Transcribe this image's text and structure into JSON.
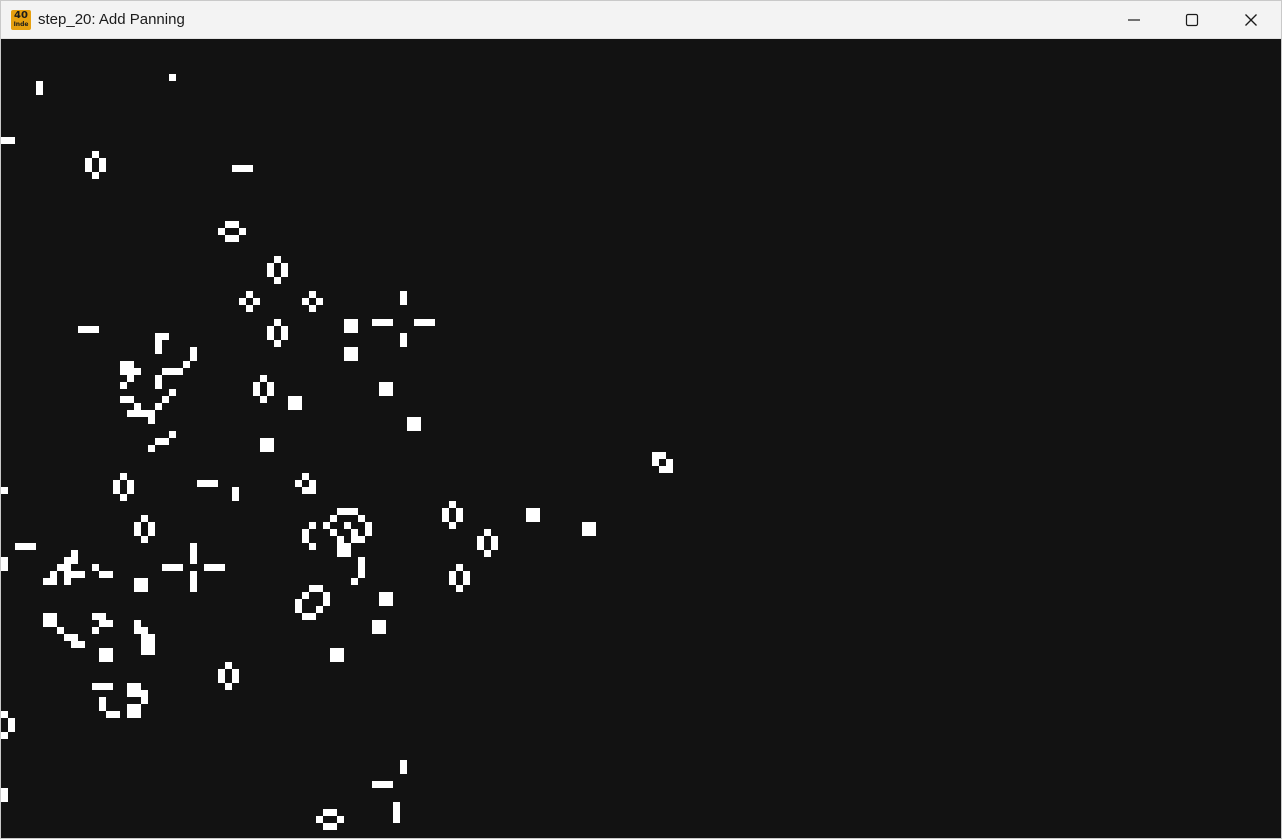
{
  "window": {
    "title": "step_20: Add Panning",
    "app_icon_text_top": "40",
    "app_icon_text_bottom": "Inde"
  },
  "controls": {
    "minimize_icon": "minimize-icon",
    "maximize_icon": "maximize-icon",
    "close_icon": "close-icon"
  },
  "simulation": {
    "background_color": "#121212",
    "cell_color": "#ffffff",
    "cell_size": 7,
    "live_cells": [
      [
        5,
        6
      ],
      [
        5,
        7
      ],
      [
        24,
        5
      ],
      [
        0,
        14
      ],
      [
        1,
        14
      ],
      [
        12,
        17
      ],
      [
        12,
        18
      ],
      [
        13,
        16
      ],
      [
        13,
        19
      ],
      [
        14,
        17
      ],
      [
        14,
        18
      ],
      [
        33,
        18
      ],
      [
        34,
        18
      ],
      [
        35,
        18
      ],
      [
        31,
        27
      ],
      [
        32,
        26
      ],
      [
        32,
        28
      ],
      [
        33,
        26
      ],
      [
        33,
        28
      ],
      [
        34,
        27
      ],
      [
        38,
        32
      ],
      [
        38,
        33
      ],
      [
        39,
        31
      ],
      [
        39,
        34
      ],
      [
        40,
        32
      ],
      [
        40,
        33
      ],
      [
        34,
        37
      ],
      [
        35,
        36
      ],
      [
        35,
        38
      ],
      [
        36,
        37
      ],
      [
        43,
        37
      ],
      [
        44,
        36
      ],
      [
        44,
        38
      ],
      [
        45,
        37
      ],
      [
        57,
        36
      ],
      [
        57,
        37
      ],
      [
        53,
        40
      ],
      [
        54,
        40
      ],
      [
        55,
        40
      ],
      [
        59,
        40
      ],
      [
        60,
        40
      ],
      [
        61,
        40
      ],
      [
        57,
        42
      ],
      [
        57,
        43
      ],
      [
        11,
        41
      ],
      [
        12,
        41
      ],
      [
        13,
        41
      ],
      [
        38,
        41
      ],
      [
        38,
        42
      ],
      [
        39,
        40
      ],
      [
        39,
        43
      ],
      [
        40,
        41
      ],
      [
        40,
        42
      ],
      [
        49,
        40
      ],
      [
        50,
        40
      ],
      [
        49,
        41
      ],
      [
        50,
        41
      ],
      [
        49,
        44
      ],
      [
        50,
        44
      ],
      [
        49,
        45
      ],
      [
        50,
        45
      ],
      [
        22,
        42
      ],
      [
        22,
        43
      ],
      [
        22,
        44
      ],
      [
        23,
        42
      ],
      [
        27,
        44
      ],
      [
        27,
        45
      ],
      [
        26,
        46
      ],
      [
        25,
        47
      ],
      [
        24,
        47
      ],
      [
        23,
        47
      ],
      [
        17,
        46
      ],
      [
        17,
        47
      ],
      [
        18,
        46
      ],
      [
        18,
        47
      ],
      [
        19,
        47
      ],
      [
        18,
        48
      ],
      [
        17,
        49
      ],
      [
        22,
        48
      ],
      [
        22,
        49
      ],
      [
        23,
        47
      ],
      [
        24,
        56
      ],
      [
        23,
        57
      ],
      [
        22,
        57
      ],
      [
        21,
        58
      ],
      [
        17,
        51
      ],
      [
        18,
        51
      ],
      [
        19,
        52
      ],
      [
        18,
        53
      ],
      [
        19,
        53
      ],
      [
        20,
        53
      ],
      [
        21,
        53
      ],
      [
        21,
        54
      ],
      [
        22,
        52
      ],
      [
        23,
        51
      ],
      [
        24,
        50
      ],
      [
        36,
        49
      ],
      [
        36,
        50
      ],
      [
        37,
        48
      ],
      [
        37,
        51
      ],
      [
        38,
        49
      ],
      [
        38,
        50
      ],
      [
        41,
        51
      ],
      [
        41,
        52
      ],
      [
        42,
        51
      ],
      [
        42,
        52
      ],
      [
        54,
        49
      ],
      [
        54,
        50
      ],
      [
        55,
        49
      ],
      [
        55,
        50
      ],
      [
        58,
        54
      ],
      [
        59,
        54
      ],
      [
        58,
        55
      ],
      [
        59,
        55
      ],
      [
        37,
        57
      ],
      [
        37,
        58
      ],
      [
        38,
        57
      ],
      [
        38,
        58
      ],
      [
        93,
        59
      ],
      [
        94,
        59
      ],
      [
        93,
        60
      ],
      [
        95,
        60
      ],
      [
        94,
        61
      ],
      [
        95,
        61
      ],
      [
        0,
        64
      ],
      [
        16,
        63
      ],
      [
        16,
        64
      ],
      [
        17,
        62
      ],
      [
        17,
        65
      ],
      [
        18,
        63
      ],
      [
        18,
        64
      ],
      [
        28,
        63
      ],
      [
        29,
        63
      ],
      [
        30,
        63
      ],
      [
        33,
        64
      ],
      [
        33,
        65
      ],
      [
        42,
        63
      ],
      [
        43,
        62
      ],
      [
        43,
        64
      ],
      [
        44,
        63
      ],
      [
        44,
        64
      ],
      [
        63,
        67
      ],
      [
        63,
        68
      ],
      [
        64,
        66
      ],
      [
        64,
        69
      ],
      [
        65,
        67
      ],
      [
        65,
        68
      ],
      [
        75,
        67
      ],
      [
        76,
        67
      ],
      [
        75,
        68
      ],
      [
        76,
        68
      ],
      [
        19,
        69
      ],
      [
        19,
        70
      ],
      [
        20,
        68
      ],
      [
        20,
        71
      ],
      [
        21,
        69
      ],
      [
        21,
        70
      ],
      [
        47,
        68
      ],
      [
        48,
        67
      ],
      [
        49,
        67
      ],
      [
        50,
        67
      ],
      [
        51,
        68
      ],
      [
        52,
        69
      ],
      [
        52,
        70
      ],
      [
        51,
        71
      ],
      [
        46,
        69
      ],
      [
        47,
        70
      ],
      [
        48,
        71
      ],
      [
        49,
        72
      ],
      [
        49,
        73
      ],
      [
        50,
        71
      ],
      [
        50,
        70
      ],
      [
        49,
        69
      ],
      [
        43,
        70
      ],
      [
        43,
        71
      ],
      [
        44,
        69
      ],
      [
        44,
        72
      ],
      [
        48,
        72
      ],
      [
        48,
        73
      ],
      [
        83,
        69
      ],
      [
        84,
        69
      ],
      [
        83,
        70
      ],
      [
        84,
        70
      ],
      [
        2,
        72
      ],
      [
        3,
        72
      ],
      [
        4,
        72
      ],
      [
        0,
        74
      ],
      [
        0,
        75
      ],
      [
        68,
        71
      ],
      [
        68,
        72
      ],
      [
        69,
        70
      ],
      [
        69,
        73
      ],
      [
        70,
        71
      ],
      [
        70,
        72
      ],
      [
        27,
        72
      ],
      [
        27,
        73
      ],
      [
        27,
        74
      ],
      [
        23,
        75
      ],
      [
        24,
        75
      ],
      [
        25,
        75
      ],
      [
        29,
        75
      ],
      [
        30,
        75
      ],
      [
        31,
        75
      ],
      [
        27,
        76
      ],
      [
        27,
        77
      ],
      [
        27,
        78
      ],
      [
        9,
        74
      ],
      [
        10,
        73
      ],
      [
        10,
        74
      ],
      [
        8,
        75
      ],
      [
        7,
        76
      ],
      [
        6,
        77
      ],
      [
        7,
        77
      ],
      [
        9,
        75
      ],
      [
        9,
        76
      ],
      [
        10,
        76
      ],
      [
        11,
        76
      ],
      [
        9,
        77
      ],
      [
        13,
        75
      ],
      [
        14,
        76
      ],
      [
        15,
        76
      ],
      [
        19,
        77
      ],
      [
        20,
        77
      ],
      [
        19,
        78
      ],
      [
        20,
        78
      ],
      [
        51,
        74
      ],
      [
        51,
        75
      ],
      [
        51,
        76
      ],
      [
        50,
        77
      ],
      [
        64,
        76
      ],
      [
        64,
        77
      ],
      [
        65,
        75
      ],
      [
        65,
        78
      ],
      [
        66,
        76
      ],
      [
        66,
        77
      ],
      [
        44,
        78
      ],
      [
        45,
        78
      ],
      [
        43,
        79
      ],
      [
        42,
        80
      ],
      [
        42,
        81
      ],
      [
        43,
        82
      ],
      [
        44,
        82
      ],
      [
        45,
        81
      ],
      [
        46,
        80
      ],
      [
        46,
        79
      ],
      [
        54,
        79
      ],
      [
        55,
        79
      ],
      [
        54,
        80
      ],
      [
        55,
        80
      ],
      [
        6,
        82
      ],
      [
        7,
        82
      ],
      [
        6,
        83
      ],
      [
        7,
        83
      ],
      [
        8,
        84
      ],
      [
        9,
        85
      ],
      [
        10,
        85
      ],
      [
        10,
        86
      ],
      [
        11,
        86
      ],
      [
        13,
        82
      ],
      [
        14,
        82
      ],
      [
        14,
        83
      ],
      [
        15,
        83
      ],
      [
        13,
        84
      ],
      [
        19,
        83
      ],
      [
        19,
        84
      ],
      [
        20,
        84
      ],
      [
        20,
        85
      ],
      [
        21,
        85
      ],
      [
        20,
        86
      ],
      [
        21,
        86
      ],
      [
        20,
        87
      ],
      [
        21,
        87
      ],
      [
        14,
        87
      ],
      [
        15,
        87
      ],
      [
        14,
        88
      ],
      [
        15,
        88
      ],
      [
        53,
        83
      ],
      [
        54,
        83
      ],
      [
        53,
        84
      ],
      [
        54,
        84
      ],
      [
        47,
        87
      ],
      [
        48,
        87
      ],
      [
        47,
        88
      ],
      [
        48,
        88
      ],
      [
        31,
        90
      ],
      [
        31,
        91
      ],
      [
        32,
        89
      ],
      [
        32,
        92
      ],
      [
        33,
        90
      ],
      [
        33,
        91
      ],
      [
        13,
        92
      ],
      [
        14,
        92
      ],
      [
        15,
        92
      ],
      [
        18,
        92
      ],
      [
        19,
        92
      ],
      [
        18,
        93
      ],
      [
        19,
        93
      ],
      [
        20,
        93
      ],
      [
        14,
        94
      ],
      [
        14,
        95
      ],
      [
        15,
        96
      ],
      [
        16,
        96
      ],
      [
        18,
        95
      ],
      [
        19,
        95
      ],
      [
        18,
        96
      ],
      [
        19,
        96
      ],
      [
        20,
        94
      ],
      [
        0,
        96
      ],
      [
        1,
        97
      ],
      [
        1,
        98
      ],
      [
        0,
        99
      ],
      [
        57,
        103
      ],
      [
        57,
        104
      ],
      [
        53,
        106
      ],
      [
        54,
        106
      ],
      [
        55,
        106
      ],
      [
        0,
        107
      ],
      [
        0,
        108
      ],
      [
        46,
        110
      ],
      [
        47,
        110
      ],
      [
        45,
        111
      ],
      [
        48,
        111
      ],
      [
        46,
        112
      ],
      [
        47,
        112
      ],
      [
        56,
        109
      ],
      [
        56,
        110
      ],
      [
        56,
        111
      ]
    ]
  }
}
